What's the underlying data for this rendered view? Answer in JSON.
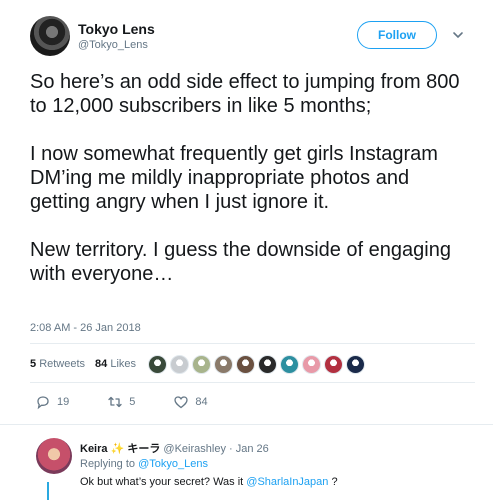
{
  "author": {
    "name": "Tokyo Lens",
    "handle": "@Tokyo_Lens"
  },
  "follow_label": "Follow",
  "tweet": {
    "paragraphs": [
      "So here’s an odd side effect to jumping from 800 to 12,000 subscribers in like 5 months;",
      "I now somewhat frequently get girls Instagram DM’ing me mildly inappropriate photos and getting angry when I just ignore it.",
      "New territory. I guess the downside of engaging with everyone…"
    ],
    "timestamp": "2:08 AM - 26 Jan 2018"
  },
  "stats": {
    "retweets_count": "5",
    "retweets_label": "Retweets",
    "likes_count": "84",
    "likes_label": "Likes"
  },
  "likers_avatar_colors": [
    "#3a4a3a",
    "#c8ccd0",
    "#a8b48c",
    "#8a7a6a",
    "#6a5040",
    "#2a2a2a",
    "#2d8fa0",
    "#e89aa8",
    "#b23040",
    "#1a2a4a"
  ],
  "actions": {
    "replies": "19",
    "retweets": "5",
    "likes": "84"
  },
  "reply": {
    "name": "Keira",
    "name_decoration": "✨",
    "name_suffix": "キーラ",
    "handle": "@Keirashley",
    "date": "· Jan 26",
    "replying_to_label": "Replying to",
    "replying_to_handle": "@Tokyo_Lens",
    "text_before": "Ok but what’s your secret? Was it",
    "mention": "@SharlaInJapan",
    "text_after": "?"
  },
  "colors": {
    "accent": "#1da1f2",
    "muted": "#657786",
    "text": "#14171a"
  }
}
